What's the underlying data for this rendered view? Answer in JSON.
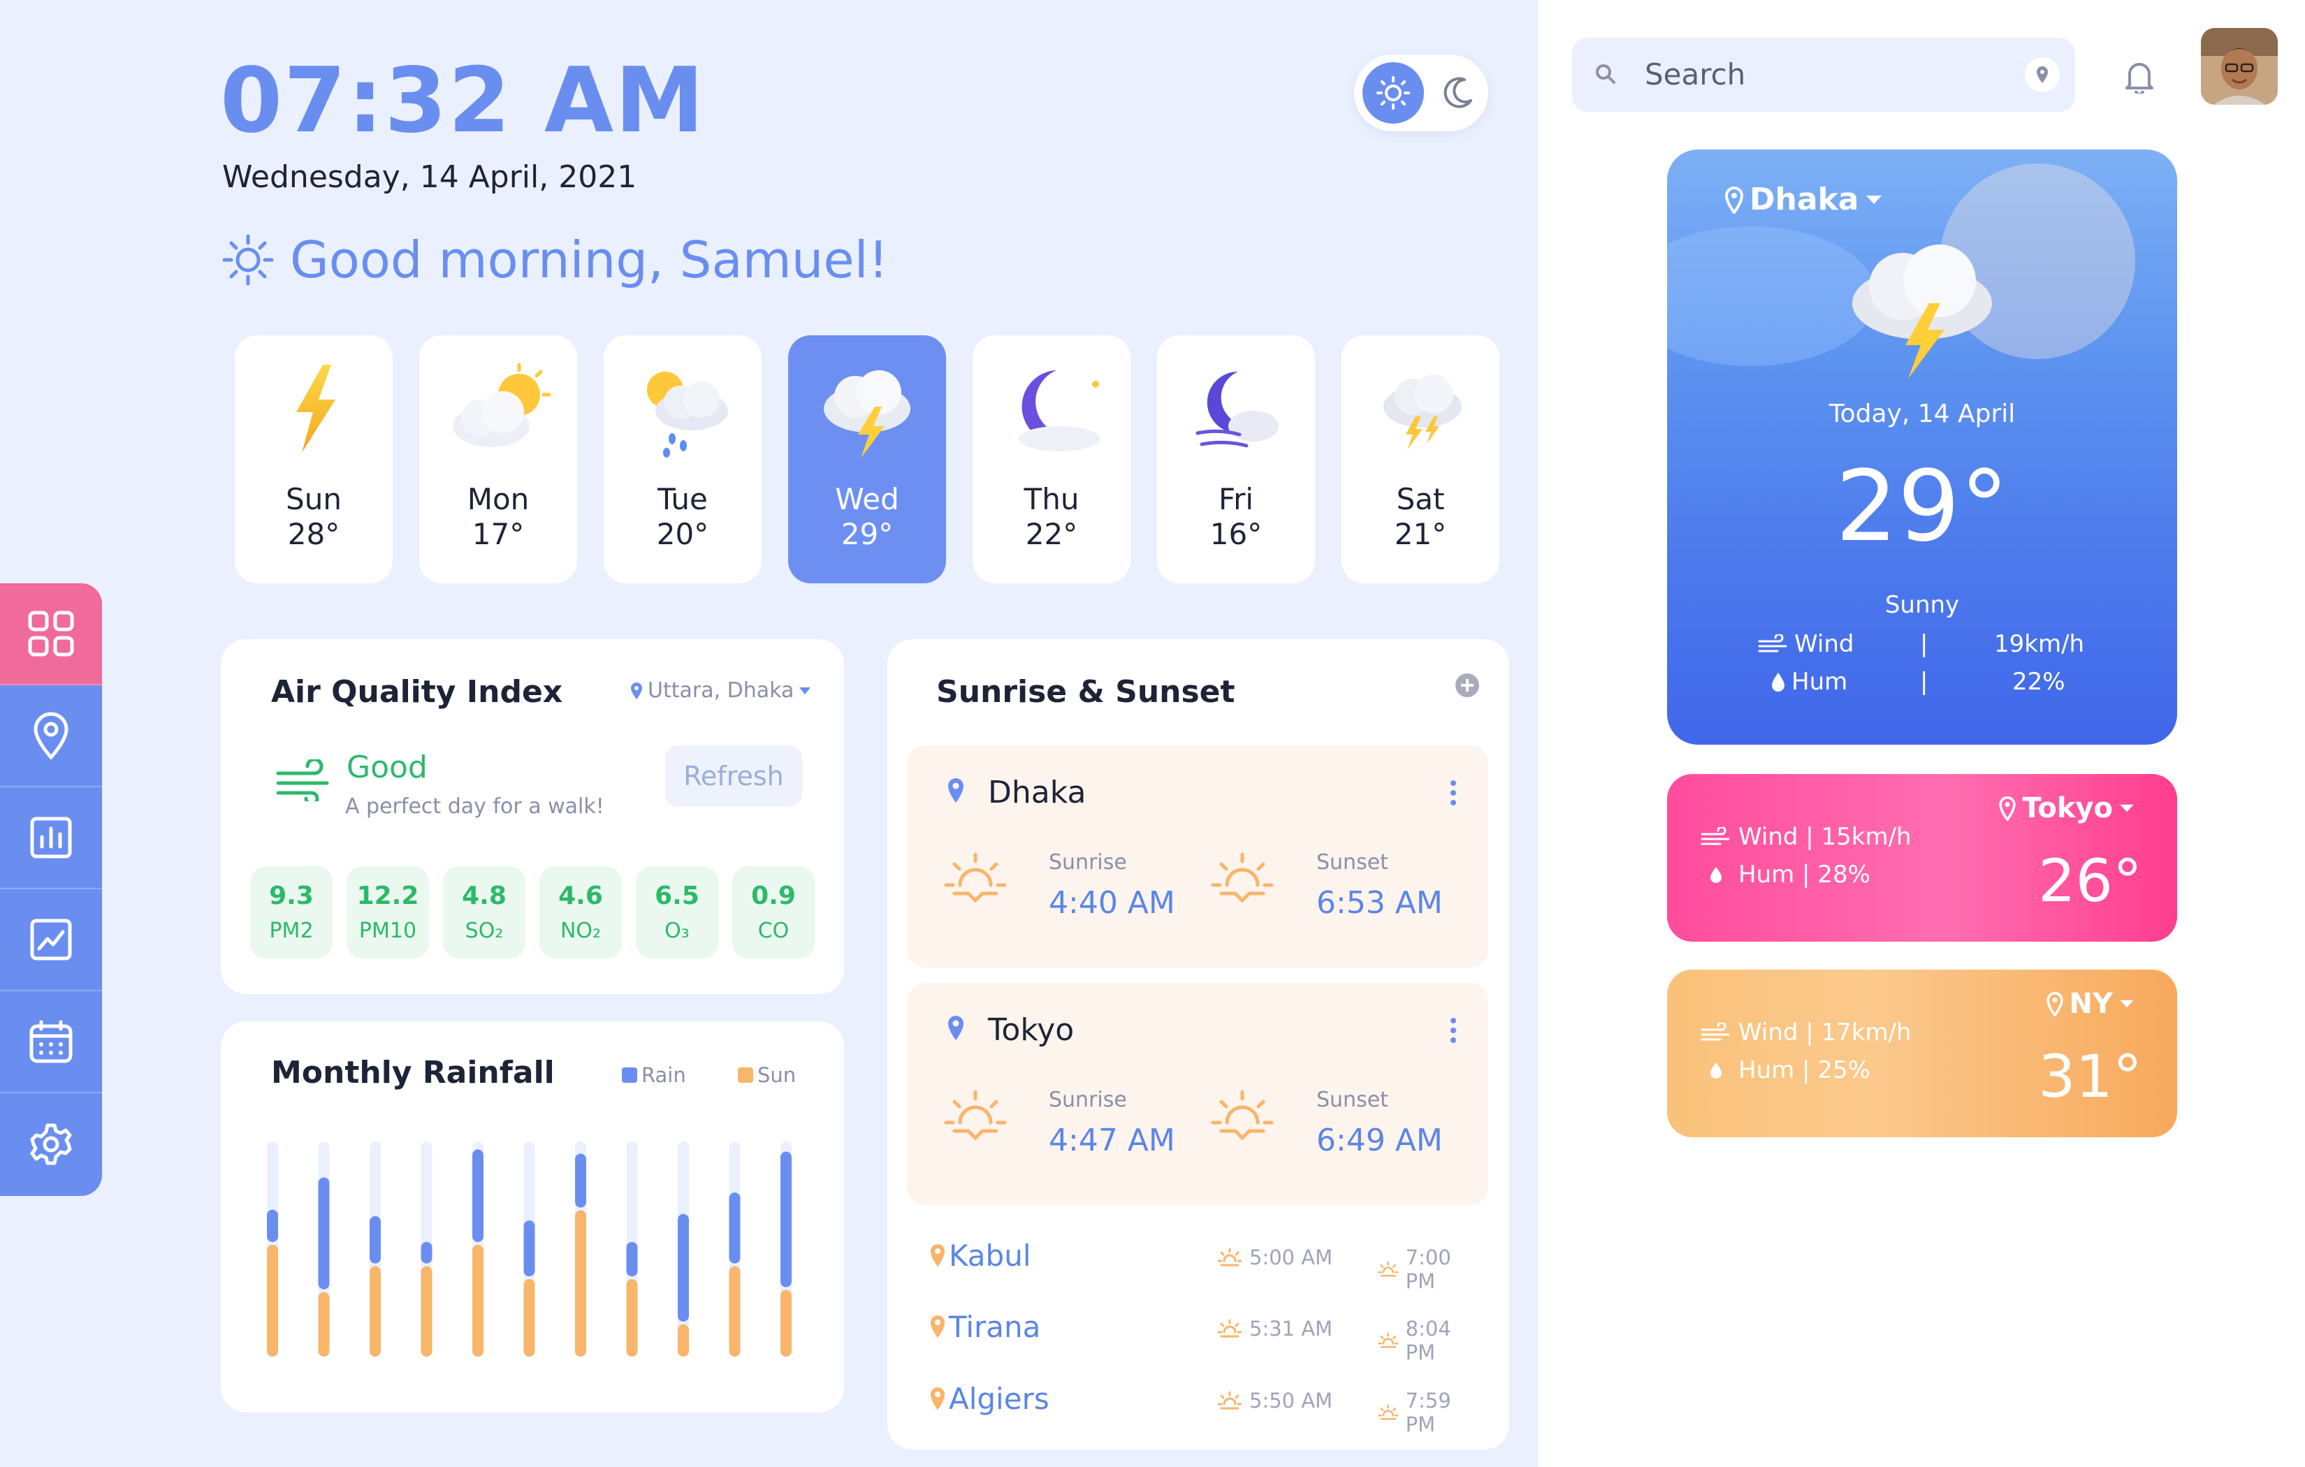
{
  "header": {
    "time": "07:32 AM",
    "date": "Wednesday, 14 April, 2021",
    "greeting": "Good morning, Samuel!"
  },
  "forecast": [
    {
      "day": "Sun",
      "temp": "28°",
      "icon": "lightning-icon"
    },
    {
      "day": "Mon",
      "temp": "17°",
      "icon": "sun-cloud-icon"
    },
    {
      "day": "Tue",
      "temp": "20°",
      "icon": "rain-cloud-icon"
    },
    {
      "day": "Wed",
      "temp": "29°",
      "icon": "thunder-cloud-icon",
      "active": true
    },
    {
      "day": "Thu",
      "temp": "22°",
      "icon": "moon-cloud-icon"
    },
    {
      "day": "Fri",
      "temp": "16°",
      "icon": "moon-wind-icon"
    },
    {
      "day": "Sat",
      "temp": "21°",
      "icon": "storm-cloud-icon"
    }
  ],
  "sidebar": {
    "items": [
      {
        "name": "dashboard",
        "icon": "grid-icon",
        "active": true
      },
      {
        "name": "location",
        "icon": "location-icon"
      },
      {
        "name": "stats",
        "icon": "bar-chart-icon"
      },
      {
        "name": "trends",
        "icon": "line-chart-icon"
      },
      {
        "name": "calendar",
        "icon": "calendar-icon"
      },
      {
        "name": "settings",
        "icon": "gear-icon"
      }
    ]
  },
  "aqi": {
    "title": "Air Quality Index",
    "location": "Uttara, Dhaka",
    "status": "Good",
    "message": "A perfect day for a walk!",
    "refresh_label": "Refresh",
    "metrics": [
      {
        "value": "9.3",
        "key": "PM2"
      },
      {
        "value": "12.2",
        "key": "PM10"
      },
      {
        "value": "4.8",
        "key": "SO₂"
      },
      {
        "value": "4.6",
        "key": "NO₂"
      },
      {
        "value": "6.5",
        "key": "O₃"
      },
      {
        "value": "0.9",
        "key": "CO"
      }
    ]
  },
  "rainfall": {
    "title": "Monthly Rainfall",
    "legend_rain": "Rain",
    "legend_sun": "Sun",
    "colors": {
      "rain": "#6a8ef0",
      "sun": "#f9b56a",
      "track": "#eaf0fd"
    },
    "chart_data": {
      "type": "bar",
      "categories": [
        "1",
        "2",
        "3",
        "4",
        "5",
        "6",
        "7",
        "8",
        "9",
        "10",
        "11"
      ],
      "series": [
        {
          "name": "Rain",
          "values": [
            0.15,
            0.52,
            0.22,
            0.1,
            0.43,
            0.26,
            0.25,
            0.16,
            0.5,
            0.33,
            0.63
          ]
        },
        {
          "name": "Sun",
          "values": [
            0.52,
            0.3,
            0.42,
            0.42,
            0.52,
            0.36,
            0.68,
            0.36,
            0.15,
            0.42,
            0.31
          ]
        }
      ],
      "ylim": [
        0,
        1
      ]
    }
  },
  "sunrise": {
    "title": "Sunrise & Sunset",
    "sunrise_label": "Sunrise",
    "sunset_label": "Sunset",
    "cities": [
      {
        "name": "Dhaka",
        "sunrise": "4:40 AM",
        "sunset": "6:53 AM"
      },
      {
        "name": "Tokyo",
        "sunrise": "4:47 AM",
        "sunset": "6:49 AM"
      }
    ],
    "others": [
      {
        "name": "Kabul",
        "sunrise": "5:00 AM",
        "sunset": "7:00 PM"
      },
      {
        "name": "Tirana",
        "sunrise": "5:31 AM",
        "sunset": "8:04 PM"
      },
      {
        "name": "Algiers",
        "sunrise": "5:50 AM",
        "sunset": "7:59 PM"
      }
    ]
  },
  "search": {
    "placeholder": "Search"
  },
  "main_weather": {
    "city": "Dhaka",
    "date": "Today, 14 April",
    "temp": "29°",
    "condition": "Sunny",
    "wind_label": "Wind",
    "wind_value": "19km/h",
    "hum_label": "Hum",
    "hum_value": "22%",
    "sep": "|"
  },
  "city_cards": [
    {
      "city": "Tokyo",
      "wind": "Wind | 15km/h",
      "hum": "Hum  | 28%",
      "temp": "26°"
    },
    {
      "city": "NY",
      "wind": "Wind | 17km/h",
      "hum": "Hum  | 25%",
      "temp": "31°"
    }
  ]
}
